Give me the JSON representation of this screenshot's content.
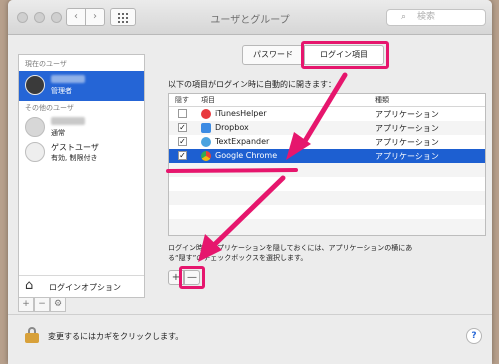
{
  "window": {
    "title": "ユーザとグループ"
  },
  "toolbar": {
    "back": "‹",
    "forward": "›",
    "search_placeholder": "検索"
  },
  "sidebar": {
    "current_section": "現在のユーザ",
    "other_section": "その他のユーザ",
    "current_user": {
      "role": "管理者"
    },
    "other_users": [
      {
        "sub": "通常"
      },
      {
        "name": "ゲストユーザ",
        "sub": "有効, 制限付き"
      }
    ],
    "login_options": "ログインオプション",
    "buttons": [
      "+",
      "−",
      "⚙"
    ]
  },
  "tabs": [
    {
      "label": "パスワード",
      "active": false
    },
    {
      "label": "ログイン項目",
      "active": true
    }
  ],
  "login_items": {
    "intro": "以下の項目がログイン時に自動的に開きます：",
    "columns": {
      "hide": "隠す",
      "item": "項目",
      "kind": "種類"
    },
    "rows": [
      {
        "name": "iTunesHelper",
        "kind": "アプリケーション",
        "checked": false,
        "icon_color": "#e8383d"
      },
      {
        "name": "Dropbox",
        "kind": "アプリケーション",
        "checked": true,
        "icon_color": "#3c8be3"
      },
      {
        "name": "TextExpander",
        "kind": "アプリケーション",
        "checked": true,
        "icon_color": "#4aa3e0"
      },
      {
        "name": "Google Chrome",
        "kind": "アプリケーション",
        "checked": true,
        "icon_color": "#f2b90f",
        "selected": true
      }
    ],
    "info_line1": "ログイン時にアプリケーションを隠しておくには、アプリケーションの横にあ",
    "info_line2": "る“隠す”のチェックボックスを選択します。",
    "add_button": "+",
    "remove_button": "—"
  },
  "footer": {
    "lock_text": "変更するにはカギをクリックします。",
    "help": "?"
  },
  "annotation_color": "#e6166d"
}
